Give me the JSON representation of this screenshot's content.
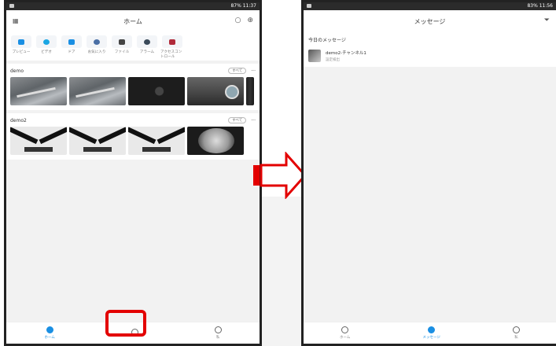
{
  "left": {
    "status": {
      "time": "11:37",
      "battery": "87%"
    },
    "header": {
      "title": "ホーム"
    },
    "shortcuts": [
      {
        "label": "プレビュー",
        "color": "#1a8fe3"
      },
      {
        "label": "ビデオ",
        "color": "#1aa6e3"
      },
      {
        "label": "ドア",
        "color": "#1a8fe3"
      },
      {
        "label": "お気に入り",
        "color": "#4a6fa5"
      },
      {
        "label": "ファイル",
        "color": "#444444"
      },
      {
        "label": "アラーム",
        "color": "#3a4a5a"
      },
      {
        "label": "アクセスコントロール",
        "color": "#b02a3a"
      }
    ],
    "groups": [
      {
        "name": "demo",
        "more_label": "すべて"
      },
      {
        "name": "demo2",
        "more_label": "すべて"
      }
    ],
    "nav": [
      {
        "label": "ホーム",
        "active": true
      },
      {
        "label": "",
        "active": false
      },
      {
        "label": "私",
        "active": false
      }
    ]
  },
  "right": {
    "status": {
      "time": "11:56",
      "battery": "83%"
    },
    "header": {
      "title": "メッセージ"
    },
    "section_title": "今日のメッセージ",
    "messages": [
      {
        "title": "demo2-チャンネル1",
        "subtitle": "設定検出"
      }
    ],
    "nav": [
      {
        "label": "ホーム",
        "active": false
      },
      {
        "label": "メッセージ",
        "active": true
      },
      {
        "label": "私",
        "active": false
      }
    ]
  }
}
